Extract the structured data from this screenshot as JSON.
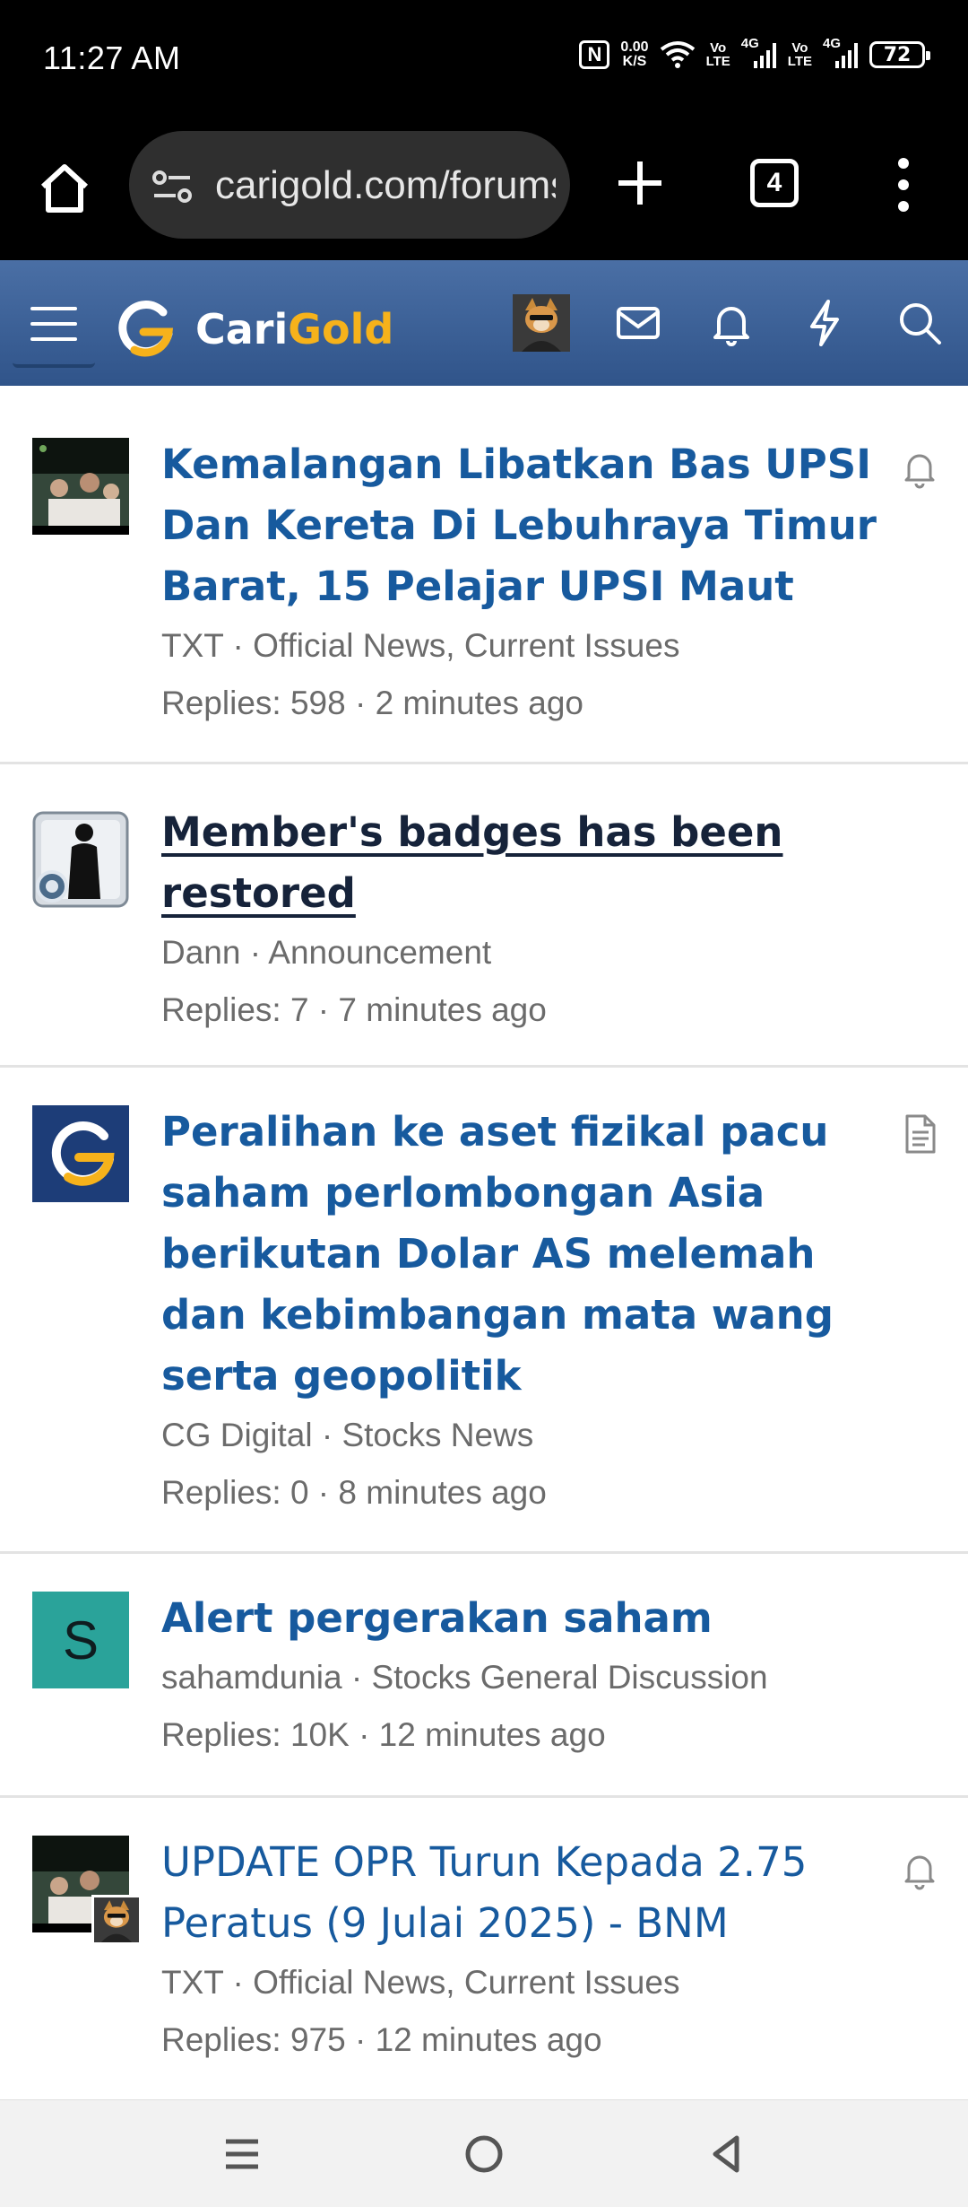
{
  "status": {
    "time": "11:27 AM",
    "net_speed_value": "0.00",
    "net_speed_unit": "K/S",
    "sim1_top": "Vo",
    "sim1_bottom": "LTE",
    "sim1_gen": "4G",
    "sim2_top": "Vo",
    "sim2_bottom": "LTE",
    "sim2_gen": "4G",
    "battery": "72",
    "nfc_label": "N"
  },
  "browser": {
    "url": "carigold.com/forums/",
    "tab_count": "4",
    "icons": [
      "home-icon",
      "tune-icon",
      "plus-icon",
      "tabs-icon",
      "more-vert-icon"
    ]
  },
  "site": {
    "logo_part1": "Cari",
    "logo_part2": "Gold",
    "brand_blue": "#3f6399",
    "brand_gold": "#f6b21b",
    "icons": [
      "menu-icon",
      "envelope-icon",
      "bell-icon",
      "bolt-icon",
      "search-icon"
    ]
  },
  "threads": [
    {
      "title": "Kemalangan Libatkan Bas UPSI Dan Kereta Di Lebuhraya Timur Barat, 15 Pelajar UPSI Maut",
      "meta": "TXT · Official News, Current Issues",
      "stats": "Replies: 598 · 2 minutes ago",
      "right_icon": "bell-icon"
    },
    {
      "title": "Member's badges has been restored",
      "meta": "Dann · Announcement",
      "stats": "Replies: 7 · 7 minutes ago"
    },
    {
      "title": "Peralihan ke aset fizikal pacu saham perlombongan Asia berikutan Dolar AS melemah dan kebimbangan mata wang serta geopolitik",
      "meta": "CG Digital · Stocks News",
      "stats": "Replies: 0 · 8 minutes ago",
      "right_icon": "document-icon"
    },
    {
      "title": "Alert pergerakan saham",
      "meta": "sahamdunia · Stocks General Discussion",
      "stats": "Replies: 10K · 12 minutes ago",
      "avatar_letter": "S"
    },
    {
      "title": "UPDATE OPR Turun Kepada 2.75 Peratus (9 Julai 2025) - BNM",
      "meta": "TXT · Official News, Current Issues",
      "stats": "Replies: 975 · 12 minutes ago",
      "right_icon": "bell-icon"
    }
  ],
  "navbar": {
    "icons": [
      "recent-apps-icon",
      "home-circle-icon",
      "back-icon"
    ]
  }
}
